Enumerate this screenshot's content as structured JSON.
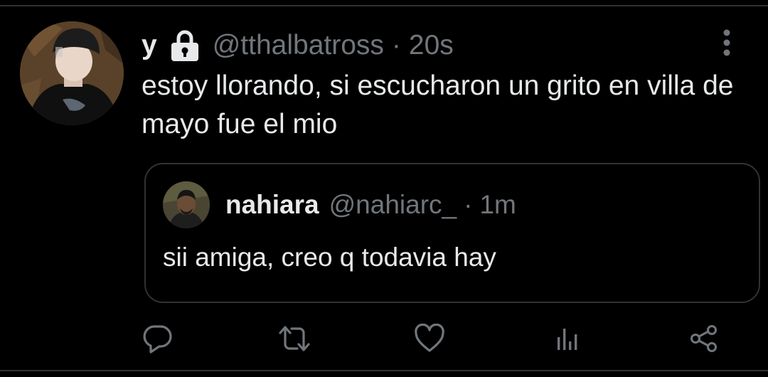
{
  "tweet": {
    "display_name": "y",
    "locked_icon": "lock-icon",
    "handle": "@tthalbatross",
    "separator": "·",
    "time": "20s",
    "text": "estoy llorando, si escucharon un grito en villa de mayo fue el mio",
    "more_icon": "more-vertical-icon"
  },
  "quoted_tweet": {
    "display_name": "nahiara",
    "handle": "@nahiarc_",
    "separator": "·",
    "time": "1m",
    "text": "sii amiga, creo q todavia hay"
  },
  "actions": [
    {
      "name": "reply",
      "icon": "reply-icon"
    },
    {
      "name": "retweet",
      "icon": "retweet-icon"
    },
    {
      "name": "like",
      "icon": "heart-icon"
    },
    {
      "name": "analytics",
      "icon": "analytics-icon"
    },
    {
      "name": "share",
      "icon": "share-icon"
    }
  ],
  "colors": {
    "background": "#000000",
    "primary_text": "#e7e9ea",
    "secondary_text": "#71767b",
    "border": "#2f3336"
  }
}
